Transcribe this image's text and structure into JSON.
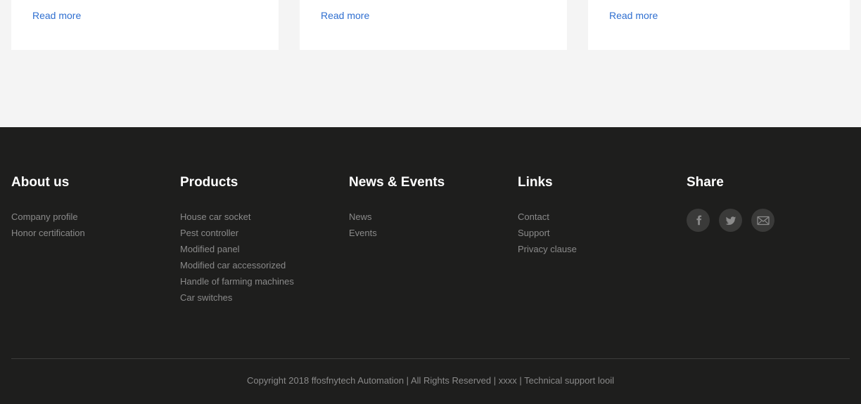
{
  "cards": [
    {
      "read_more_label": "Read more"
    },
    {
      "read_more_label": "Read more"
    },
    {
      "read_more_label": "Read more"
    }
  ],
  "footer": {
    "background_color": "#1e1e1d",
    "columns": [
      {
        "title": "About us",
        "links": [
          "Company profile",
          "Honor certification"
        ]
      },
      {
        "title": "Products",
        "links": [
          "House car socket",
          "Pest controller",
          "Modified panel",
          "Modified car accessorized",
          "Handle of farming machines",
          "Car switches"
        ]
      },
      {
        "title": "News & Events",
        "links": [
          "News",
          "Events"
        ]
      },
      {
        "title": "Links",
        "links": [
          "Contact",
          "Support",
          "Privacy clause"
        ]
      }
    ],
    "share": {
      "title": "Share",
      "icons": [
        "facebook-icon",
        "twitter-icon",
        "email-icon"
      ],
      "icon_background_color": "#3a3a39",
      "icon_glyph_color": "#8a8a8a"
    },
    "copyright": "Copyright 2018 ffosfnytech Automation | All Rights Reserved | xxxx | Technical support looil",
    "link_color": "#8a8a8a",
    "title_color": "#ffffff"
  },
  "theme": {
    "page_background": "#f4f4f4",
    "card_background": "#ffffff",
    "link_accent": "#2f6fd0"
  }
}
